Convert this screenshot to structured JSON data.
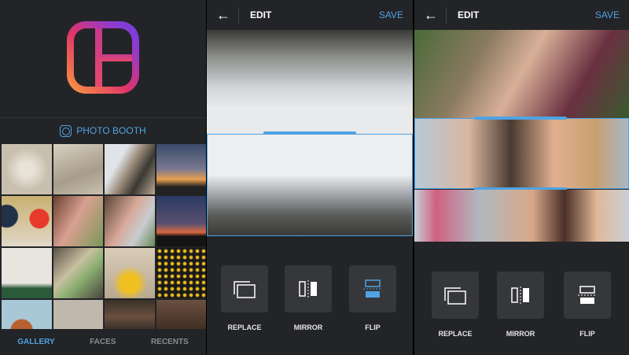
{
  "gallery_screen": {
    "photo_booth_label": "PHOTO BOOTH",
    "tabs": [
      {
        "label": "GALLERY",
        "active": true
      },
      {
        "label": "FACES",
        "active": false
      },
      {
        "label": "RECENTS",
        "active": false
      }
    ],
    "accent": "#4fa3e3"
  },
  "edit_screen_flip": {
    "title": "EDIT",
    "save_label": "SAVE",
    "tools": [
      {
        "label": "REPLACE",
        "icon": "replace-icon"
      },
      {
        "label": "MIRROR",
        "icon": "mirror-icon"
      },
      {
        "label": "FLIP",
        "icon": "flip-icon",
        "active": true
      }
    ]
  },
  "edit_screen_selfie": {
    "title": "EDIT",
    "save_label": "SAVE",
    "tools": [
      {
        "label": "REPLACE",
        "icon": "replace-icon"
      },
      {
        "label": "MIRROR",
        "icon": "mirror-icon"
      },
      {
        "label": "FLIP",
        "icon": "flip-icon"
      }
    ]
  }
}
